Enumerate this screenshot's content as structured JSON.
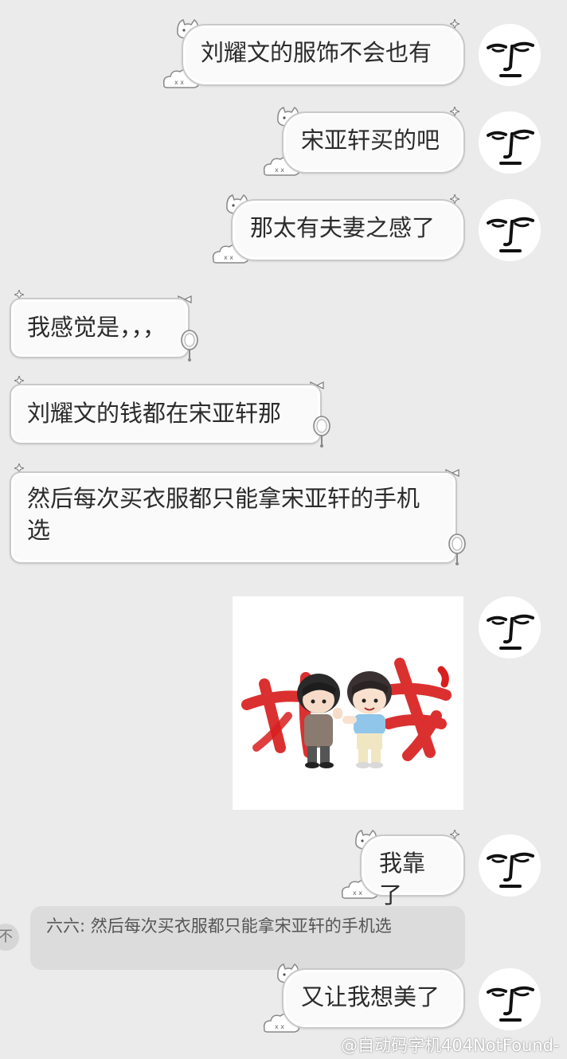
{
  "chat": {
    "messages": [
      {
        "side": "out",
        "text": "刘耀文的服饰不会也有"
      },
      {
        "side": "out",
        "text": "宋亚轩买的吧"
      },
      {
        "side": "out",
        "text": "那太有夫妻之感了"
      },
      {
        "side": "in",
        "text": "我感觉是，，，"
      },
      {
        "side": "in",
        "text": "刘耀文的钱都在宋亚轩那"
      },
      {
        "side": "in",
        "text": "然后每次买衣服都只能拿宋亚轩的手机选"
      },
      {
        "side": "out",
        "type": "image",
        "text": ""
      },
      {
        "side": "out",
        "text": "我靠了"
      },
      {
        "side": "out",
        "text": "又让我想美了"
      }
    ],
    "quote": {
      "text": "六六: 然后每次买衣服都只能拿宋亚轩的手机选",
      "side_glyph": "不"
    },
    "sticker_icon": "cartoon-couple-sticker"
  },
  "watermark": "@自动码字机404NotFound-",
  "colors": {
    "background": "#ebebeb",
    "bubble": "#fafafa",
    "bubble_border": "#c9c9c9",
    "quote_bg": "#dcdcdc",
    "sticker_red": "#d81e1e"
  }
}
